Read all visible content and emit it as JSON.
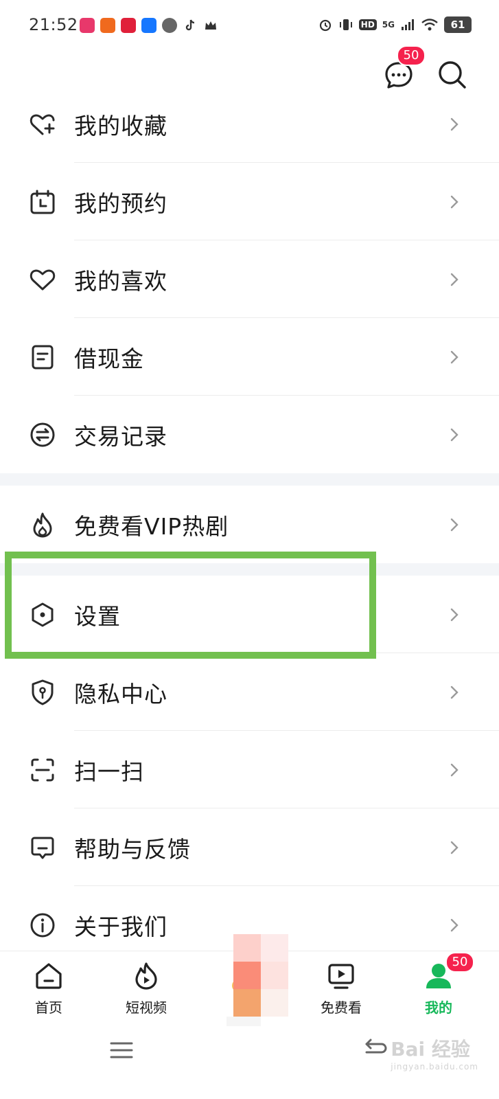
{
  "status_bar": {
    "time": "21:52",
    "hd": "HD",
    "network": "5G",
    "battery": "61"
  },
  "header": {
    "messages_badge": "50"
  },
  "menu": {
    "items": [
      {
        "label": "我的收藏",
        "icon": "heart-plus-icon"
      },
      {
        "label": "我的预约",
        "icon": "calendar-icon"
      },
      {
        "label": "我的喜欢",
        "icon": "heart-icon"
      },
      {
        "label": "借现金",
        "icon": "note-icon"
      },
      {
        "label": "交易记录",
        "icon": "exchange-icon"
      },
      {
        "label": "免费看VIP热剧",
        "icon": "flame-icon"
      },
      {
        "label": "设置",
        "icon": "hexagon-settings-icon"
      },
      {
        "label": "隐私中心",
        "icon": "shield-icon"
      },
      {
        "label": "扫一扫",
        "icon": "scan-icon"
      },
      {
        "label": "帮助与反馈",
        "icon": "chat-bubble-icon"
      },
      {
        "label": "关于我们",
        "icon": "info-icon"
      }
    ]
  },
  "tabbar": {
    "home": "首页",
    "short_video": "短视频",
    "free_watch": "免费看",
    "mine": "我的",
    "mine_badge": "50"
  },
  "watermark": {
    "main": "Bai 经验",
    "sub": "jingyan.baidu.com"
  },
  "colors": {
    "accent_green": "#17b85a",
    "highlight_box": "#72c04f",
    "badge_red": "#f5224d"
  }
}
